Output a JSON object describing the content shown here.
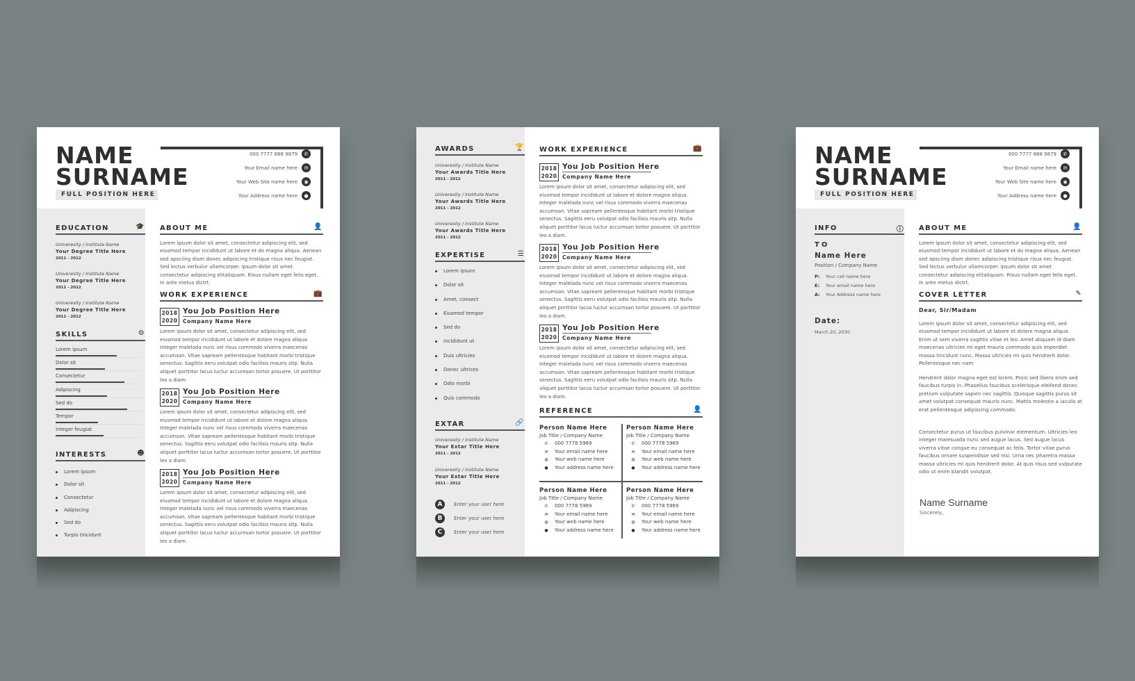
{
  "header": {
    "name_line1": "NAME",
    "name_line2": "SURNAME",
    "position": "FULL POSITION HERE",
    "contacts": [
      {
        "icon": "phone-icon",
        "glyph": "✆",
        "text": "000 7777 888 9879"
      },
      {
        "icon": "email-icon",
        "glyph": "✉",
        "text": "Your Email name here"
      },
      {
        "icon": "globe-icon",
        "glyph": "◉",
        "text": "Your Web Site name here"
      },
      {
        "icon": "location-icon",
        "glyph": "●",
        "text": "Your Address name here"
      }
    ]
  },
  "resume": {
    "education": {
      "title": "EDUCATION",
      "icon": "graduation-cap-icon",
      "entries": [
        {
          "institution": "Univeresity / Institute Name",
          "degree": "Your Degree Title Here",
          "years": "2011 - 2012"
        },
        {
          "institution": "Univeresity / Institute Name",
          "degree": "Your Degree Title Here",
          "years": "2011 - 2012"
        },
        {
          "institution": "Univeresity / Institute Name",
          "degree": "Your Degree Title Here",
          "years": "2011 - 2012"
        }
      ]
    },
    "skills": {
      "title": "SKILLS",
      "icon": "gear-icon",
      "items": [
        {
          "name": "Lorem ipsum",
          "level": 0.71
        },
        {
          "name": "Dolor sit",
          "level": 0.57
        },
        {
          "name": "Consectetur",
          "level": 0.8
        },
        {
          "name": "Adipiscing",
          "level": 0.6
        },
        {
          "name": "Sed do",
          "level": 0.83
        },
        {
          "name": "Tempor",
          "level": 0.49
        },
        {
          "name": "Integer feugiat",
          "level": 0.56
        }
      ]
    },
    "interests": {
      "title": "INTERESTS",
      "icon": "head-icon",
      "items": [
        "Lorem ipsum",
        "Dolor sit",
        "Consectetur",
        "Adipiscing",
        "Sed do",
        "Turpis tincidunt"
      ]
    },
    "about": {
      "title": "ABOUT ME",
      "icon": "user-icon",
      "text": "Lorem ipsum dolor sit amet, consectetur adipiscing elit, sed eiusmod tempor incididunt ut labore et do magna aliqua. Aenean sed apsciing diam donec adipiscing tristique risus nec feugiat. Sed lectus verbulur ullamcorper. Ipsum dolor sit amet consectetur adipiscing elitaliquam. Risus nullam eget felis eget. In ante metus dictrt."
    },
    "work": {
      "title": "WORK EXPERIENCE",
      "icon": "briefcase-icon",
      "jobs": [
        {
          "start": "2018",
          "end": "2020",
          "position": "You Job Position Here",
          "company": "Company Name Here",
          "description": "Lorem ipsum dolor sit amet, consectetur adipiscing elit, sed eiusmod tempor incididunt ut labore et dolore magna aliqua. Integer malelada nunc vel risus commodo viverra maecenas accumsan. Vitae sapream pellentesque habitant morbi tristique senectus. Sagittis eeru volutpat odio facilisis mauris sitp. Nulla aliquet porttitor lacus luctur accumsan tortor posuere. Ut porttitor leo a diam."
        },
        {
          "start": "2018",
          "end": "2020",
          "position": "You Job Position Here",
          "company": "Company Name Here",
          "description": "Lorem ipsum dolor sit amet, consectetur adipiscing elit, sed eiusmod tempor incididunt ut labore et dolore magna aliqua. Integer malelada nunc vel risus commodo viverra maecenas accumsan. Vitae sapream pellentesque habitant morbi tristique senectus. Sagittis eeru volutpat odio facilisis mauris sitp. Nulla aliquet porttitor lacus luctur accumsan tortor posuere. Ut porttitor leo a diam."
        },
        {
          "start": "2018",
          "end": "2020",
          "position": "You Job Position Here",
          "company": "Company Name Here",
          "description": "Lorem ipsum dolor sit amet, consectetur adipiscing elit, sed eiusmod tempor incididunt ut labore et dolore magna aliqua. Integer malelada nunc vel risus commodo viverra maecenas accumsan. Vitae sapream pellentesque habitant morbi tristique senectus. Sagittis eeru volutpat odio facilisis mauris sitp. Nulla aliquet porttitor lacus luctur accumsan tortor posuere. Ut porttitor leo a diam."
        }
      ]
    }
  },
  "page2": {
    "awards": {
      "title": "AWARDS",
      "icon": "trophy-icon",
      "entries": [
        {
          "institution": "Univeresity / Institute Name",
          "title": "Your Awards Title Here",
          "years": "2011 - 2012"
        },
        {
          "institution": "Univeresity / Institute Name",
          "title": "Your Awards Title Here",
          "years": "2011 - 2012"
        },
        {
          "institution": "Univeresity / Institute Name",
          "title": "Your Awards Title Here",
          "years": "2011 - 2012"
        }
      ]
    },
    "expertise": {
      "title": "EXPERTISE",
      "icon": "document-icon",
      "items": [
        "Lorem ipsum",
        "Dolor sit",
        "Amet, consect",
        "Eiusmod tempor",
        "Sed do",
        "Incididunt ut",
        "Duis ultricies",
        "Donec ultrices",
        "Odio morbi",
        "Quis commodo"
      ]
    },
    "extar": {
      "title": "EXTAR",
      "icon": "link-icon",
      "entries": [
        {
          "institution": "Univeresity / Institute Name",
          "title": "Your Extar Title Here",
          "years": "2011 - 2012"
        },
        {
          "institution": "Univeresity / Institute Name",
          "title": "Your Extar Title Here",
          "years": "2011 - 2012"
        }
      ]
    },
    "users": [
      {
        "letter": "A",
        "text": "Enter your user here"
      },
      {
        "letter": "B",
        "text": "Enter your user here"
      },
      {
        "letter": "C",
        "text": "Enter your user here"
      }
    ],
    "reference": {
      "title": "REFERENCE",
      "icon": "user-icon",
      "people": [
        {
          "name": "Person Name Here",
          "job": "Job Title / Company Name",
          "phone": "000 7778 5969",
          "email": "Your email name here",
          "web": "Your web name here",
          "address": "Your address name here"
        },
        {
          "name": "Person Name Here",
          "job": "Job Title / Company Name",
          "phone": "000 7778 5969",
          "email": "Your email name here",
          "web": "Your web name here",
          "address": "Your address name here"
        },
        {
          "name": "Person Name Here",
          "job": "Job Title / Company Name",
          "phone": "000 7778 5969",
          "email": "Your email name here",
          "web": "Your web name here",
          "address": "Your address name here"
        },
        {
          "name": "Person Name Here",
          "job": "Job Title / Company Name",
          "phone": "000 7778 5969",
          "email": "Your email name here",
          "web": "Your web name here",
          "address": "Your address name here"
        }
      ]
    }
  },
  "cover": {
    "info": {
      "title": "INFO",
      "icon": "info-icon",
      "to": "TO",
      "name": "Name Here",
      "position": "Position / Company Name",
      "rows": [
        {
          "label": "P:",
          "text": "Your  call name here"
        },
        {
          "label": "E:",
          "text": "Your  email name here"
        },
        {
          "label": "A:",
          "text": "Your  Address name here"
        }
      ],
      "date_label": "Date:",
      "date_value": "March 20, 2030"
    },
    "letter": {
      "title": "COVER LETTER",
      "icon": "pencil-icon",
      "greeting": "Dear, Sir/Madam",
      "paragraphs": [
        "Lorem ipsum dolor sit amet, consectetur adipiscing elit, sed eiusmod tempor incididunt ut labore et dolore magna aliqua. Enim ut sem viverra sagittis vitae et leo. Amet aliquam id diam maecenas ultricies mi eget mauris commodo quis imperdiet massa tincidunt nunc. Massa ultricies mi quis hendrerit dolor. Pellentesque nec nam",
        "Hendrerit dolor magna eget est lorem. Proin sed libero enim sed faucibus turpis in. Phasellus faucibus scelerisque eleifend donec pretium vulputate sapien nec sagittis. Quisque sagittis purus sit amet volutpat consequat mauris nunc. Mattis molestie a iaculis at erat pellentesque adipiscing commodo.",
        "Consectetur purus ut faucibus pulvinar elementum. Ultricies leo integer malesuada nunc sed augue lacus. Sed augue lacus viverra vitae congue eu consequat ac felis. Tortor vitae purus faucibus ornare suspendisse sed nisi. Urna nec pharetra massa massa ultricies mi quis hendrerit dolor. At quis risus sed vulputate odio ut enim blandit volutpat."
      ],
      "signature_name": "Name Surname",
      "signature_closing": "Sincerely,"
    }
  }
}
